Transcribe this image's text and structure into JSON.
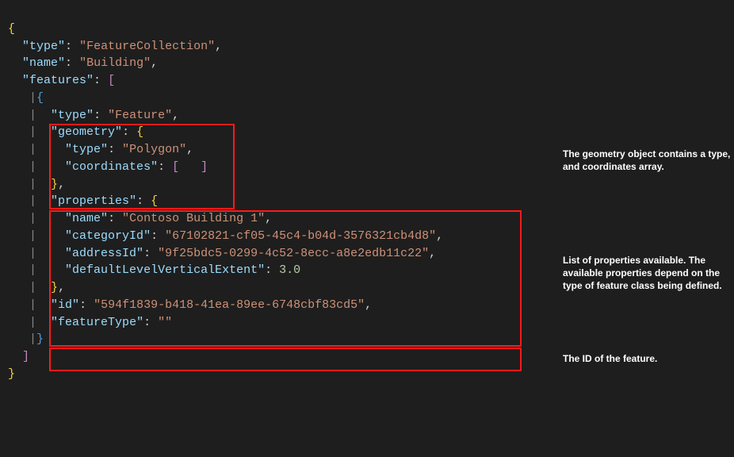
{
  "code": {
    "line1": {
      "k_type": "\"type\"",
      "v_type": "\"FeatureCollection\""
    },
    "line2": {
      "k_name": "\"name\"",
      "v_name": "\"Building\""
    },
    "line3": {
      "k_features": "\"features\""
    },
    "line5": {
      "k_type": "\"type\"",
      "v_type": "\"Feature\""
    },
    "line6": {
      "k_geometry": "\"geometry\""
    },
    "line7": {
      "k_type": "\"type\"",
      "v_type": "\"Polygon\""
    },
    "line8": {
      "k_coordinates": "\"coordinates\""
    },
    "line10": {
      "k_properties": "\"properties\""
    },
    "line11": {
      "k_name": "\"name\"",
      "v_name": "\"Contoso Building 1\""
    },
    "line12": {
      "k_categoryId": "\"categoryId\"",
      "v_categoryId": "\"67102821-cf05-45c4-b04d-3576321cb4d8\""
    },
    "line13": {
      "k_addressId": "\"addressId\"",
      "v_addressId": "\"9f25bdc5-0299-4c52-8ecc-a8e2edb11c22\""
    },
    "line14": {
      "k_defaultLevelVerticalExtent": "\"defaultLevelVerticalExtent\"",
      "v_defaultLevelVerticalExtent": "3.0"
    },
    "line16": {
      "k_id": "\"id\"",
      "v_id": "\"594f1839-b418-41ea-89ee-6748cbf83cd5\""
    },
    "line17": {
      "k_featureType": "\"featureType\"",
      "v_featureType": "\"\""
    }
  },
  "annotations": {
    "geometry": "The geometry object contains a type, and coordinates array.",
    "properties": "List of properties available. The available properties depend on the type of feature class being defined.",
    "id": "The ID of the feature."
  }
}
